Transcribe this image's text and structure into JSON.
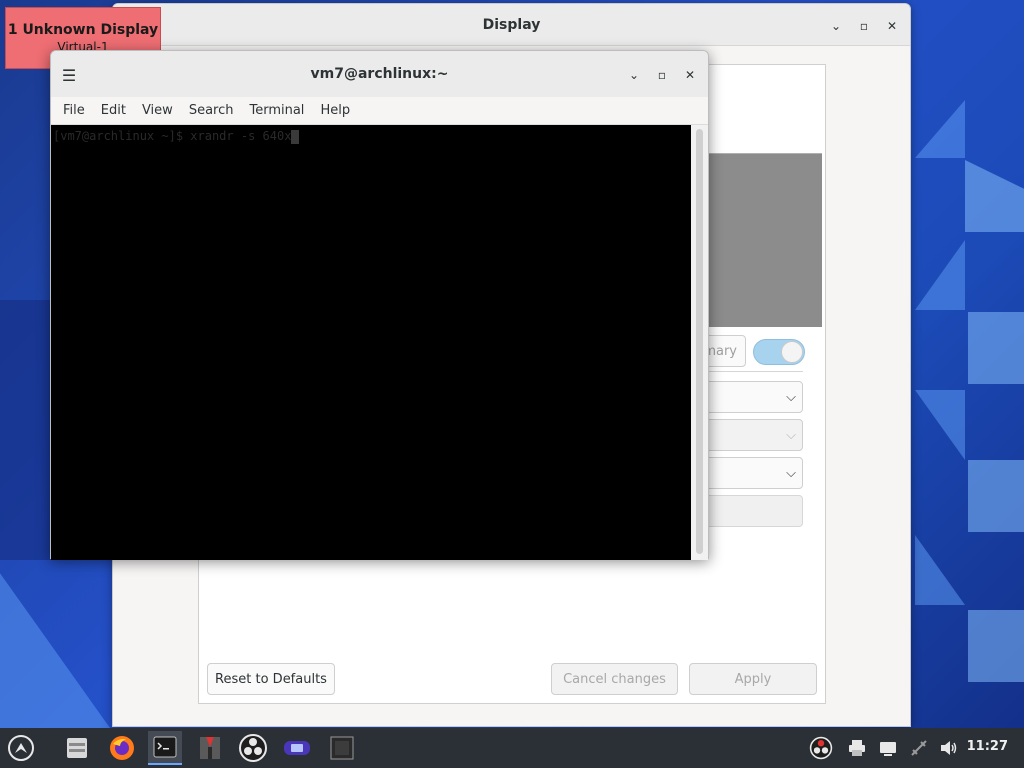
{
  "display_window": {
    "title": "Display",
    "primary_label": "mary",
    "buttons": {
      "reset": "Reset to Defaults",
      "cancel": "Cancel changes",
      "apply": "Apply"
    }
  },
  "display_label": {
    "name": "1  Unknown Display",
    "sub": "Virtual-1"
  },
  "terminal": {
    "title": "vm7@archlinux:~",
    "menu": [
      "File",
      "Edit",
      "View",
      "Search",
      "Terminal",
      "Help"
    ],
    "prompt_line": "[vm7@archlinux ~]$ xrandr -s 640x"
  },
  "taskbar": {
    "clock": "11:27"
  },
  "colors": {
    "accent": "#6aa6ff",
    "display_label_bg": "#ee6e73",
    "terminal_bg": "#000000"
  }
}
